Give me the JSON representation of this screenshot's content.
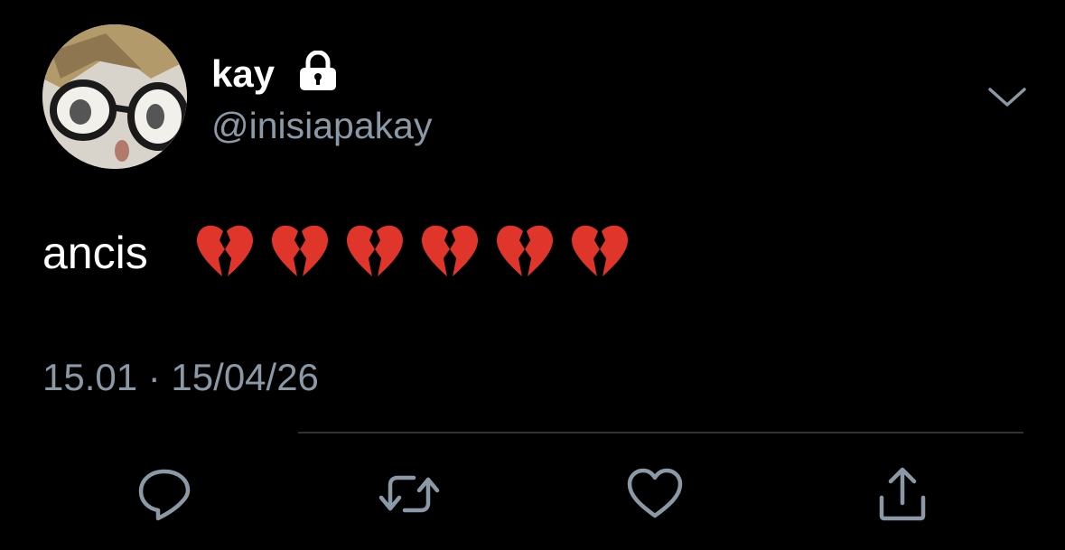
{
  "user": {
    "display_name": "kay",
    "handle": "@inisiapakay",
    "protected_icon": "lock-icon",
    "avatar_desc": "avatar"
  },
  "tweet": {
    "text": "ancis",
    "emoji": [
      "💔",
      "💔",
      "💔",
      "💔",
      "💔",
      "💔"
    ],
    "timestamp": "15.01 · 15/04/26"
  },
  "actions": [
    {
      "name": "reply",
      "icon": "speech-bubble-icon"
    },
    {
      "name": "retweet",
      "icon": "retweet-icon"
    },
    {
      "name": "like",
      "icon": "heart-outline-icon"
    },
    {
      "name": "share",
      "icon": "share-icon"
    }
  ],
  "colors": {
    "background": "#000000",
    "primary_text": "#ffffff",
    "secondary_text": "#8b98a5",
    "divider": "#2f3336",
    "broken_heart": "#e0352b"
  }
}
